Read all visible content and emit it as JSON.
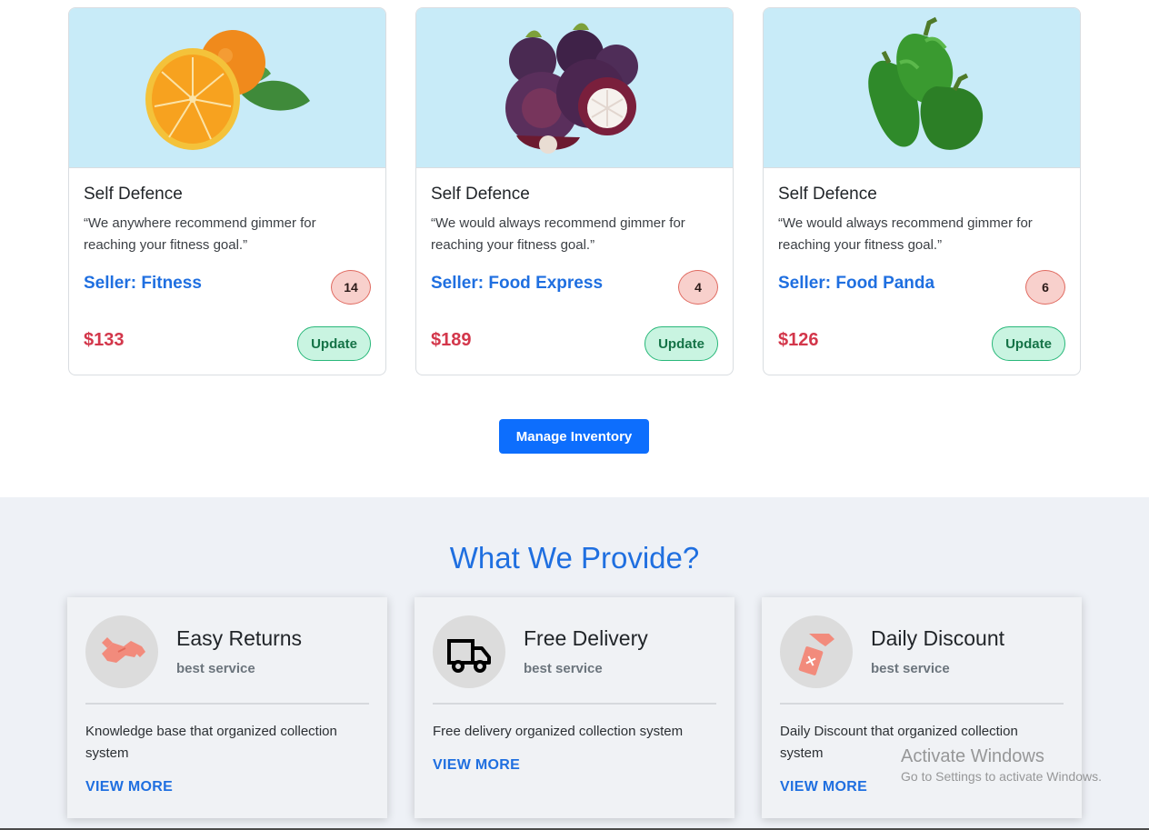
{
  "products": [
    {
      "title": "Self Defence",
      "description": "“We anywhere recommend gimmer for reaching your fitness goal.”",
      "seller": "Seller: Fitness",
      "count": "14",
      "price": "$133",
      "update_label": "Update",
      "image": "orange-image"
    },
    {
      "title": "Self Defence",
      "description": "“We would always recommend gimmer for reaching your fitness goal.”",
      "seller": "Seller: Food Express",
      "count": "4",
      "price": "$189",
      "update_label": "Update",
      "image": "mangosteen-image"
    },
    {
      "title": "Self Defence",
      "description": "“We would always recommend gimmer for reaching your fitness goal.”",
      "seller": "Seller: Food Panda",
      "count": "6",
      "price": "$126",
      "update_label": "Update",
      "image": "green-pepper-image"
    }
  ],
  "manage_inventory_label": "Manage Inventory",
  "services": {
    "heading": "What We Provide?",
    "items": [
      {
        "title": "Easy Returns",
        "subtitle": "best service",
        "description": "Knowledge base that organized collection system",
        "link": "VIEW MORE",
        "icon": "handshake-icon"
      },
      {
        "title": "Free Delivery",
        "subtitle": "best service",
        "description": "Free delivery organized collection system",
        "link": "VIEW MORE",
        "icon": "truck-icon"
      },
      {
        "title": "Daily Discount",
        "subtitle": "best service",
        "description": "Daily Discount that organized collection system",
        "link": "VIEW MORE",
        "icon": "discount-tag-icon"
      }
    ]
  },
  "watermark": {
    "line1": "Activate Windows",
    "line2": "Go to Settings to activate Windows."
  },
  "colors": {
    "accent": "#1f6fe0",
    "price": "#d3374b",
    "update_bg": "#c9f4e1",
    "badge_bg": "#f8d0cc",
    "image_bg": "#c8ebf8",
    "section_bg": "#eef1f6"
  }
}
